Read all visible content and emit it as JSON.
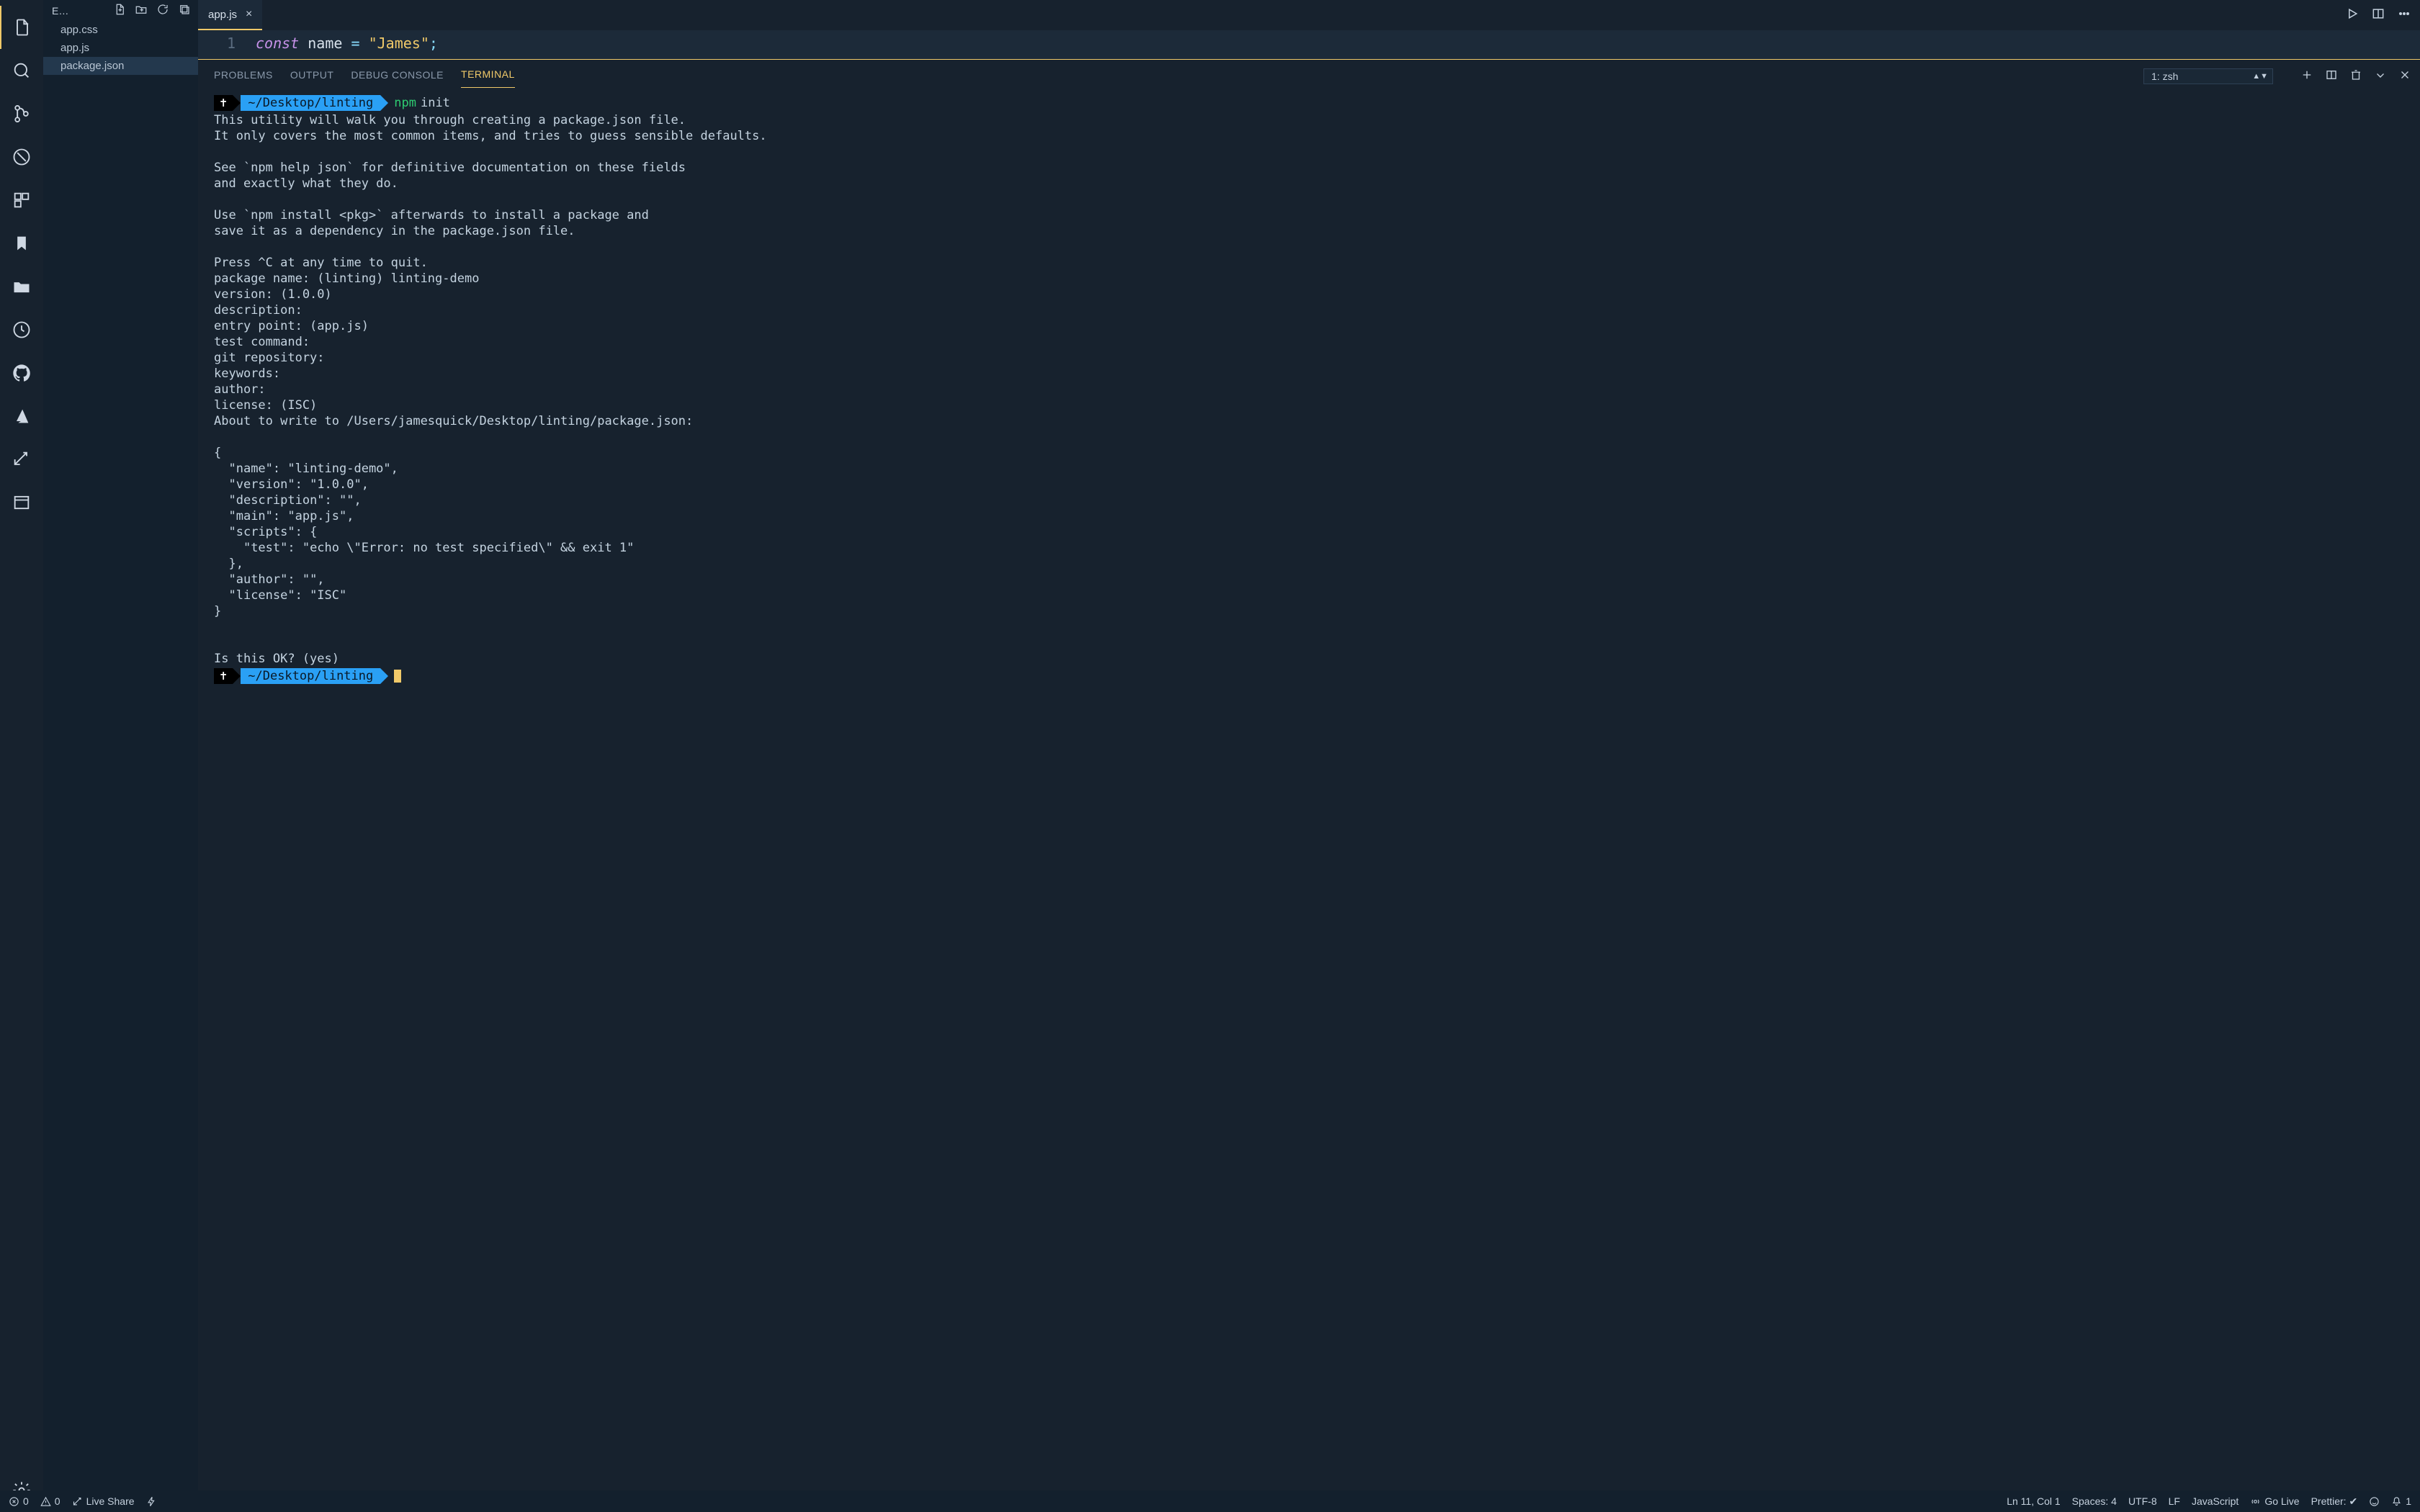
{
  "sidebar": {
    "header_label": "E…",
    "files": [
      "app.css",
      "app.js",
      "package.json"
    ],
    "selected_index": 2
  },
  "tab": {
    "label": "app.js"
  },
  "editor": {
    "line_number": "1",
    "tok_const": "const",
    "tok_name": "name",
    "tok_eq": "=",
    "tok_str": "\"James\"",
    "tok_semi": ";"
  },
  "panel": {
    "tabs": [
      "PROBLEMS",
      "OUTPUT",
      "DEBUG CONSOLE",
      "TERMINAL"
    ],
    "active_index": 3,
    "terminal_selector": "1: zsh"
  },
  "terminal": {
    "prompt1_symbol": "✝",
    "prompt1_path": "~/Desktop/linting",
    "prompt1_cmd_a": "npm",
    "prompt1_cmd_b": "init",
    "lines": [
      "This utility will walk you through creating a package.json file.",
      "It only covers the most common items, and tries to guess sensible defaults.",
      "",
      "See `npm help json` for definitive documentation on these fields",
      "and exactly what they do.",
      "",
      "Use `npm install <pkg>` afterwards to install a package and",
      "save it as a dependency in the package.json file.",
      "",
      "Press ^C at any time to quit.",
      "package name: (linting) linting-demo",
      "version: (1.0.0) ",
      "description: ",
      "entry point: (app.js) ",
      "test command: ",
      "git repository: ",
      "keywords: ",
      "author: ",
      "license: (ISC) ",
      "About to write to /Users/jamesquick/Desktop/linting/package.json:",
      "",
      "{",
      "  \"name\": \"linting-demo\",",
      "  \"version\": \"1.0.0\",",
      "  \"description\": \"\",",
      "  \"main\": \"app.js\",",
      "  \"scripts\": {",
      "    \"test\": \"echo \\\"Error: no test specified\\\" && exit 1\"",
      "  },",
      "  \"author\": \"\",",
      "  \"license\": \"ISC\"",
      "}",
      "",
      "",
      "Is this OK? (yes) "
    ],
    "prompt2_symbol": "✝",
    "prompt2_path": "~/Desktop/linting"
  },
  "statusbar": {
    "errors": "0",
    "warnings": "0",
    "live_share": "Live Share",
    "cursor_pos": "Ln 11, Col 1",
    "spaces": "Spaces: 4",
    "encoding": "UTF-8",
    "eol": "LF",
    "language": "JavaScript",
    "go_live": "Go Live",
    "prettier": "Prettier: ✔",
    "bell_count": "1"
  }
}
